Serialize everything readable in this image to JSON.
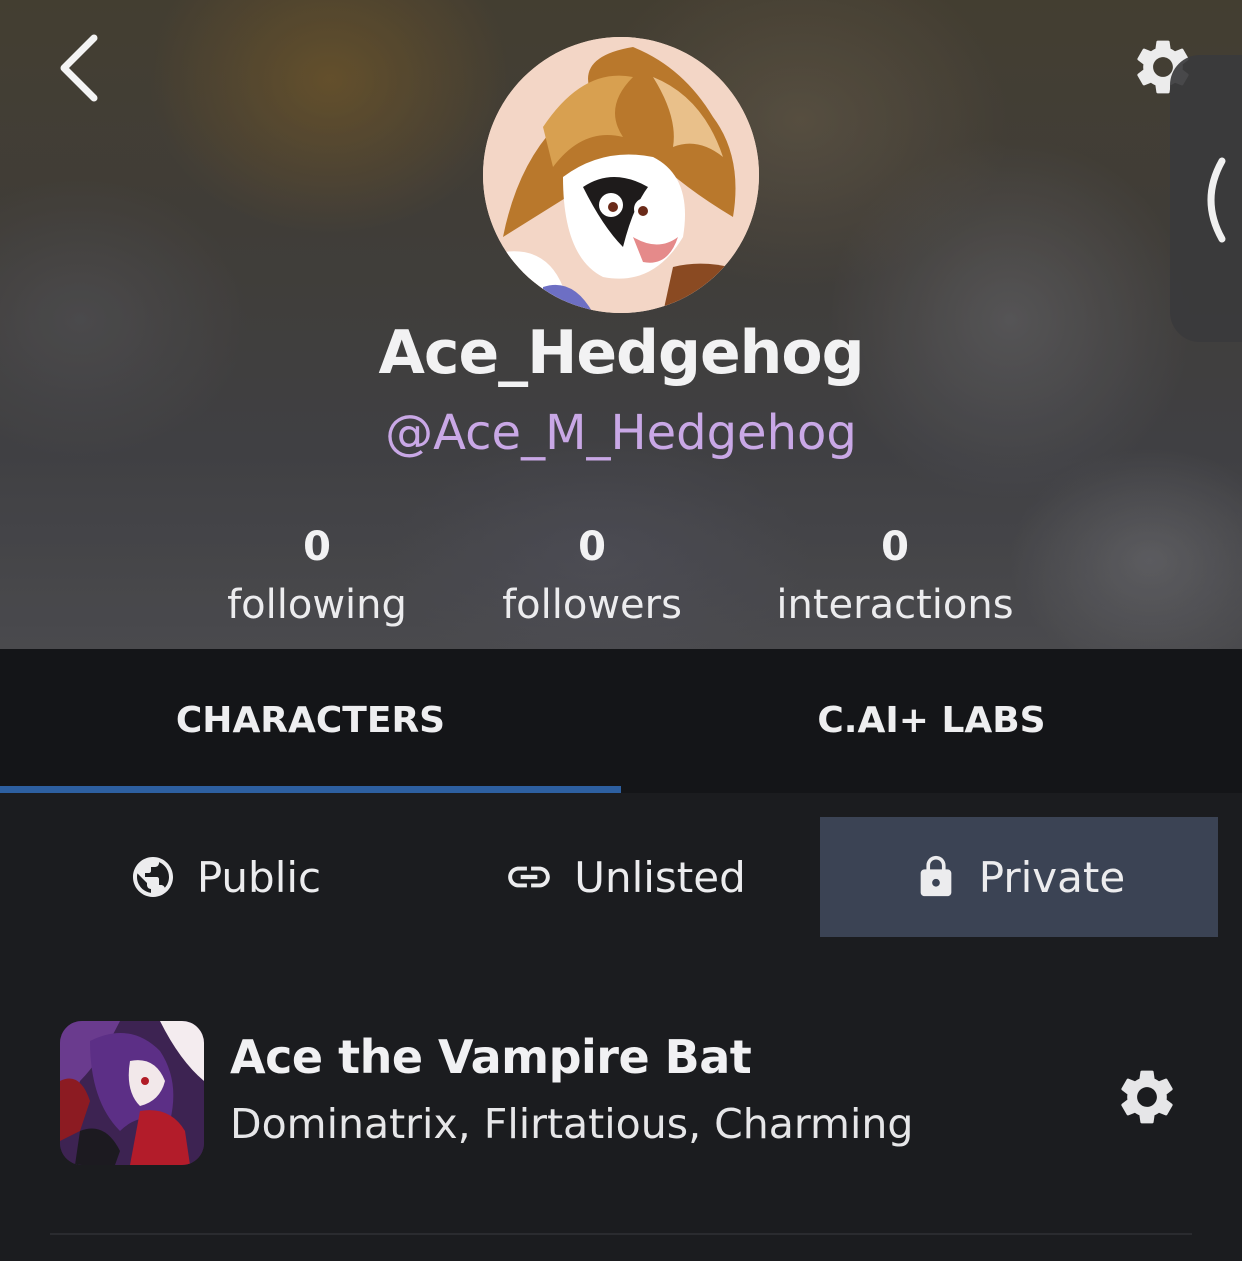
{
  "profile": {
    "display_name": "Ace_Hedgehog",
    "handle": "@Ace_M_Hedgehog",
    "stats": [
      {
        "value": "0",
        "label": "following"
      },
      {
        "value": "0",
        "label": "followers"
      },
      {
        "value": "0",
        "label": "interactions"
      }
    ]
  },
  "tabs": [
    {
      "label": "CHARACTERS",
      "selected": true
    },
    {
      "label": "C.AI+ LABS",
      "selected": false
    }
  ],
  "visibility_filter": [
    {
      "label": "Public",
      "icon": "globe-icon",
      "selected": false
    },
    {
      "label": "Unlisted",
      "icon": "link-icon",
      "selected": false
    },
    {
      "label": "Private",
      "icon": "lock-icon",
      "selected": true
    }
  ],
  "characters": [
    {
      "name": "Ace the Vampire Bat",
      "description": "Dominatrix, Flirtatious, Charming"
    }
  ],
  "colors": {
    "handle": "#c9a8e6",
    "tab_underline": "#2d5fa0",
    "selected_filter_bg": "#3b4354",
    "page_bg": "#1b1c1f"
  }
}
